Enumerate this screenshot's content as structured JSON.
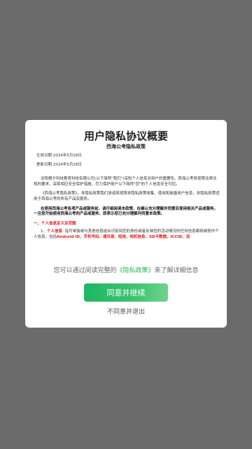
{
  "dialog": {
    "title": "用户隐私协议概要",
    "subtitle": "西海公考隐私政策",
    "effective_date": "生效日期:2024年5月28日",
    "updated_date": "更新日期:2024年5月28日",
    "para1": "沈阳橙夕科技教育科技有限公司(以下简称\"我们\")深知个人信息对用户的重要性。西海公考将按照法律法规的要求，采取相应安全保护措施，尽力保护用户以下简称\"您\"的个人信息安全可控。",
    "para2": "《西海公考隐私政策》，本隐私政策我们承诺将按照本隐私政策收集、使用和披露用户信息，本隐私政策适用于西海公考的所有产品及服务。",
    "para3": "在使用西海公考各项产品或服务前，请仔细阅读本政策，在确认充分理解并同意后使用相关产品或服务。一旦您开始使用西海公考的产品或服务，即表示您已充分理解并同意本政策。",
    "section1": "一、个人信息定义及范围",
    "para4_prefix": "1、",
    "para4_term": "个人信息",
    "para4_text": ": 指可单独或与其他信息结合识别到您的身份或者反映您的活动情况的任何信息都将被视作个人信息，包括",
    "para4_items": "Android ID、手机号码、通讯录、短信、相机信息、SD卡数据、ICCID、设",
    "notice_prefix": "您可以通过阅读完整的",
    "notice_link": "《隐私政策》",
    "notice_suffix": "来了解详细信息",
    "agree_button": "同意并继续",
    "disagree_link": "不同意并退出"
  }
}
